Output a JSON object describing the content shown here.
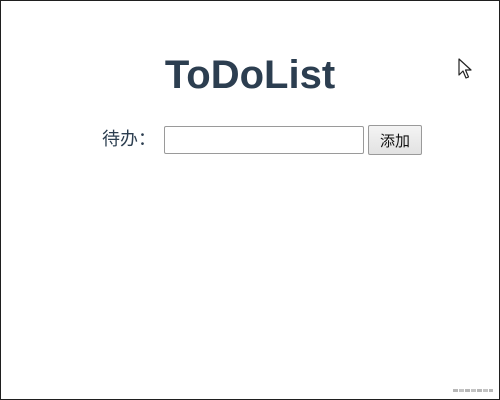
{
  "app": {
    "title": "ToDoList"
  },
  "form": {
    "label": "待办：",
    "input_value": "",
    "input_placeholder": "",
    "add_label": "添加"
  },
  "icons": {
    "cursor": "arrow-cursor-icon",
    "watermark": "watermark-logo"
  },
  "colors": {
    "title": "#2c3e50",
    "label": "#2c3e50",
    "border": "#1f1f1f"
  }
}
